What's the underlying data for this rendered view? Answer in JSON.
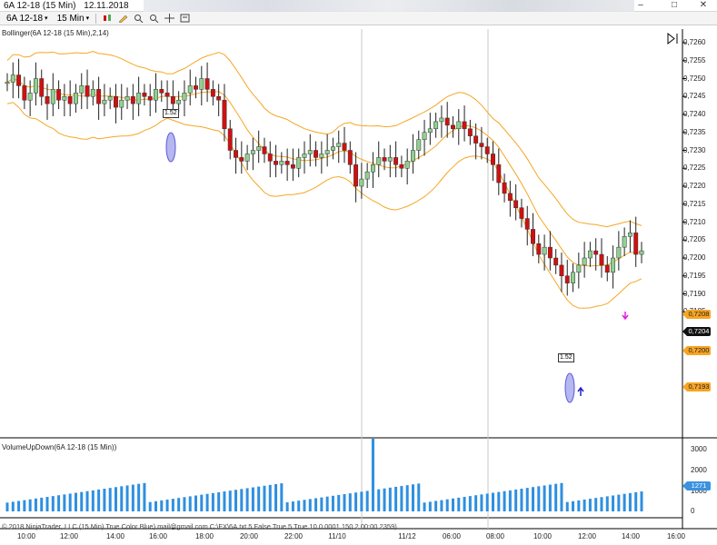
{
  "window": {
    "title_instrument": "6A 12-18 (15 Min)",
    "title_date": "12.11.2018",
    "min_glyph": "–",
    "max_glyph": "□",
    "close_glyph": "✕"
  },
  "toolbar": {
    "instrument": "6A 12-18",
    "interval": "15 Min",
    "caret": "▾"
  },
  "indicators": {
    "price_panel_label": "Bollinger(6A 12-18 (15 Min),2,14)",
    "volume_panel_label": "VolumeUpDown(6A 12-18 (15 Min))"
  },
  "price_axis": {
    "ticks": [
      "0,7260",
      "0,7255",
      "0,7250",
      "0,7245",
      "0,7240",
      "0,7235",
      "0,7230",
      "0,7225",
      "0,7220",
      "0,7215",
      "0,7210",
      "0,7205",
      "0,7200",
      "0,7195",
      "0,7190",
      "0,7185"
    ]
  },
  "price_flags": {
    "upper_band": "0,7208",
    "last_price": "0,7204",
    "middle_band": "0,7200",
    "lower_band": "0,7193"
  },
  "volume_axis": {
    "ticks": [
      "3000",
      "2000",
      "1000",
      "0"
    ],
    "last_volume": "1271"
  },
  "time_axis": {
    "labels": [
      "10:00",
      "12:00",
      "14:00",
      "16:00",
      "18:00",
      "20:00",
      "22:00",
      "11/10",
      "11/12",
      "06:00",
      "08:00",
      "10:00",
      "12:00",
      "14:00",
      "16:00"
    ]
  },
  "markers": {
    "box_label_1": "1.52",
    "box_label_2": "1.52"
  },
  "footer": {
    "text": "© 2018 NinjaTrader, LLC    (15 Min) True Color Blue) mail@gmail.com C:\\FX\\6A.txt 5 False True 5 True 10 0.0001 150 2 00:00 2359)"
  },
  "colors": {
    "up_candle": "#8fd18f",
    "down_candle": "#d01010",
    "band": "#f5a623",
    "volume": "#2e8fe0"
  }
}
